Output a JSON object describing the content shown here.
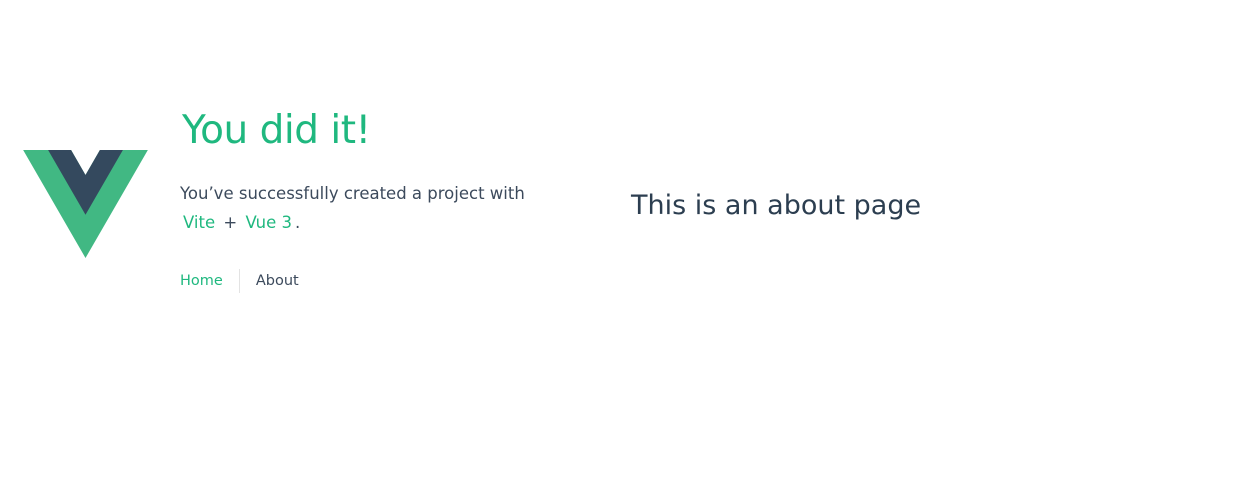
{
  "header": {
    "logo_icon": "vue-logo-icon",
    "title": "You did it!",
    "subtitle_prefix": "You’ve successfully created a project with",
    "link_vite": "Vite",
    "plus": "+",
    "link_vue": "Vue 3",
    "period": ".",
    "nav": {
      "home": "Home",
      "about": "About"
    }
  },
  "main": {
    "heading": "This is an about page"
  },
  "colors": {
    "accent": "#1fb87f",
    "logo_green": "#41b883",
    "logo_dark": "#34495e",
    "text": "#2c3e50"
  }
}
